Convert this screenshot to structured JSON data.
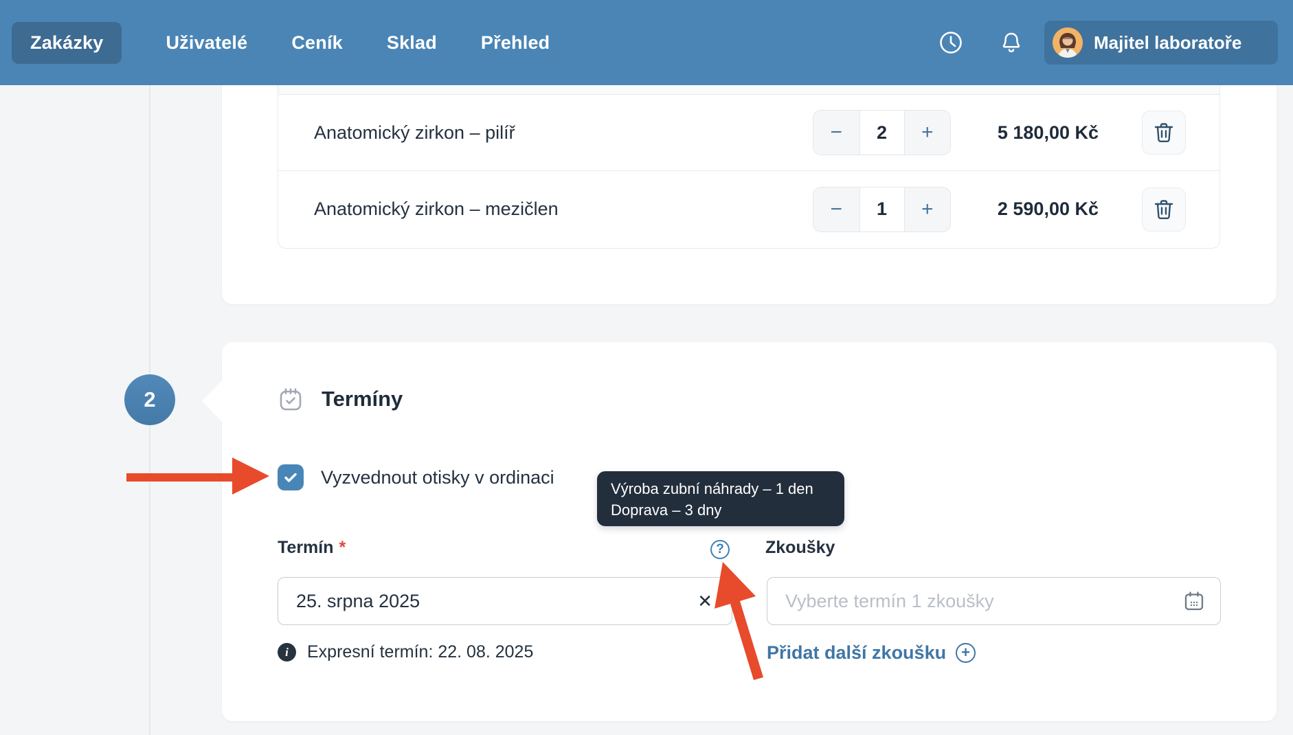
{
  "nav": {
    "tabs": [
      {
        "label": "Zakázky",
        "active": true
      },
      {
        "label": "Uživatelé",
        "active": false
      },
      {
        "label": "Ceník",
        "active": false
      },
      {
        "label": "Sklad",
        "active": false
      },
      {
        "label": "Přehled",
        "active": false
      }
    ],
    "user": {
      "name": "Majitel laboratoře"
    }
  },
  "products": {
    "stepper": {
      "decrease": "−",
      "increase": "+"
    },
    "rows": [
      {
        "name": "Anatomický zirkon – pilíř",
        "qty": "2",
        "price": "5 180,00 Kč"
      },
      {
        "name": "Anatomický zirkon – mezičlen",
        "qty": "1",
        "price": "2 590,00 Kč"
      }
    ]
  },
  "terminy": {
    "step_number": "2",
    "title": "Termíny",
    "checkbox_label": "Vyzvednout otisky v ordinaci",
    "tooltip": {
      "line1": "Výroba zubní náhrady – 1 den",
      "line2": "Doprava – 3 dny"
    },
    "termin": {
      "label": "Termín",
      "required_mark": "*",
      "value": "25. srpna 2025",
      "clear_glyph": "✕",
      "help_glyph": "?",
      "express_note": "Expresní termín: 22. 08. 2025",
      "info_glyph": "i"
    },
    "zkousky": {
      "label": "Zkoušky",
      "placeholder": "Vyberte termín 1 zkoušky",
      "add_label": "Přidat další zkoušku",
      "add_glyph": "+"
    }
  },
  "colors": {
    "navbar_blue": "#4a85b5",
    "active_tab_blue": "#3d6b92",
    "checkbox_blue": "#4886b8",
    "link_blue": "#4076a6",
    "tooltip_bg": "#232e3c",
    "arrow_red": "#e84a2c"
  }
}
